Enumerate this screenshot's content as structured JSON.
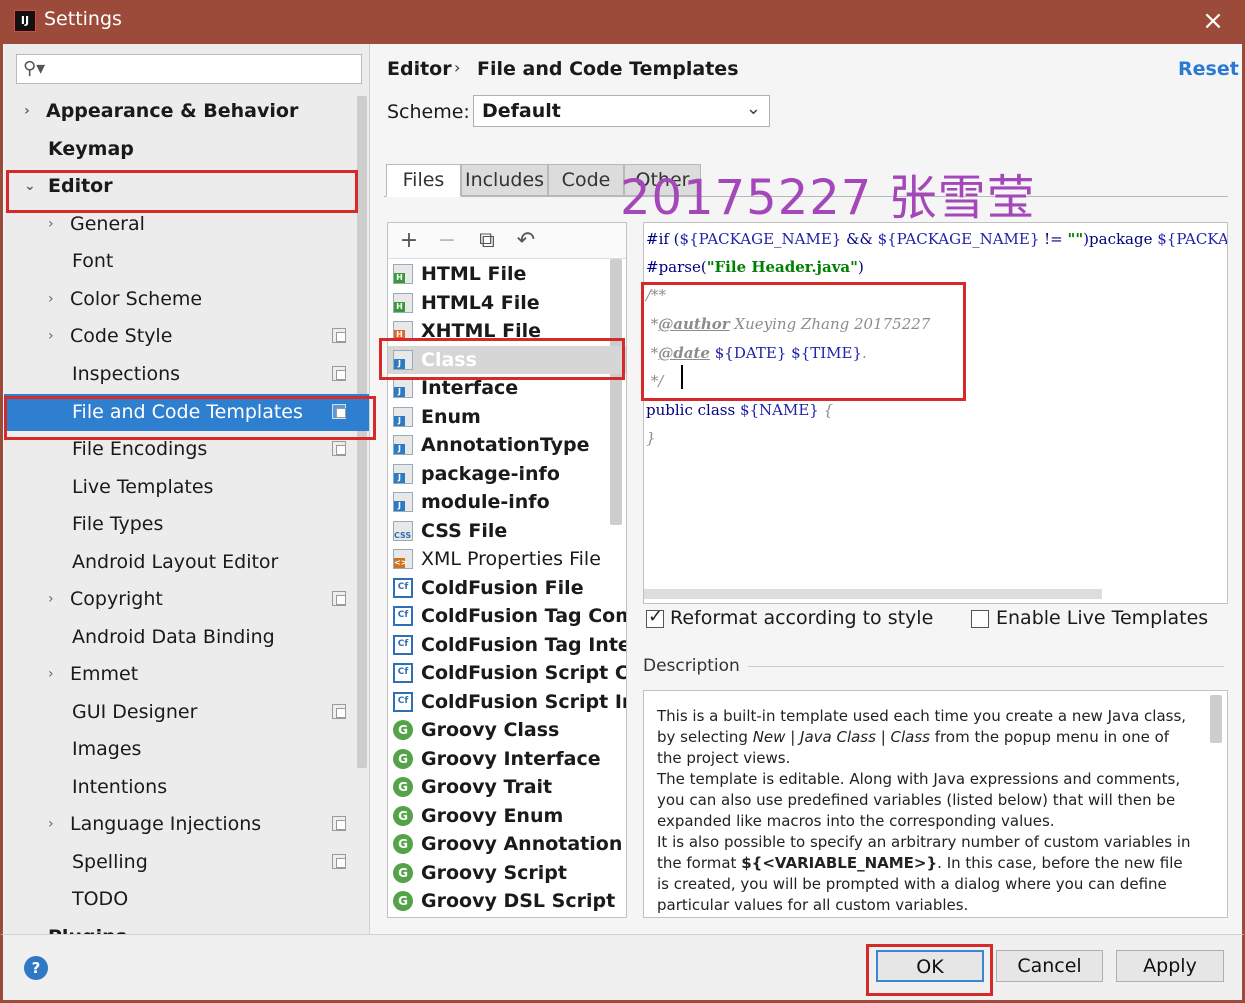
{
  "window": {
    "title": "Settings",
    "app_icon_text": "IJ",
    "close_symbol": "×"
  },
  "sidebar": {
    "search_placeholder": "",
    "items": [
      {
        "label": "Appearance & Behavior"
      },
      {
        "label": "Keymap"
      },
      {
        "label": "Editor"
      },
      {
        "label": "General"
      },
      {
        "label": "Font"
      },
      {
        "label": "Color Scheme"
      },
      {
        "label": "Code Style"
      },
      {
        "label": "Inspections"
      },
      {
        "label": "File and Code Templates"
      },
      {
        "label": "File Encodings"
      },
      {
        "label": "Live Templates"
      },
      {
        "label": "File Types"
      },
      {
        "label": "Android Layout Editor"
      },
      {
        "label": "Copyright"
      },
      {
        "label": "Android Data Binding"
      },
      {
        "label": "Emmet"
      },
      {
        "label": "GUI Designer"
      },
      {
        "label": "Images"
      },
      {
        "label": "Intentions"
      },
      {
        "label": "Language Injections"
      },
      {
        "label": "Spelling"
      },
      {
        "label": "TODO"
      },
      {
        "label": "Plugins"
      }
    ]
  },
  "header": {
    "breadcrumb": [
      "Editor",
      "File and Code Templates"
    ],
    "breadcrumb_sep": "›",
    "reset_label": "Reset",
    "scheme_label": "Scheme:",
    "scheme_value": "Default"
  },
  "tabs": [
    {
      "label": "Files"
    },
    {
      "label": "Includes"
    },
    {
      "label": "Code"
    },
    {
      "label": "Other"
    }
  ],
  "watermark": "20175227 张雪莹",
  "templates": [
    {
      "label": "HTML File",
      "badge": "H"
    },
    {
      "label": "HTML4 File",
      "badge": "H"
    },
    {
      "label": "XHTML File",
      "badge": "H"
    },
    {
      "label": "Class",
      "badge": "J"
    },
    {
      "label": "Interface",
      "badge": "J"
    },
    {
      "label": "Enum",
      "badge": "J"
    },
    {
      "label": "AnnotationType",
      "badge": "J"
    },
    {
      "label": "package-info",
      "badge": "J"
    },
    {
      "label": "module-info",
      "badge": "J"
    },
    {
      "label": "CSS File",
      "badge": "CSS"
    },
    {
      "label": "XML Properties File",
      "badge": "<>"
    },
    {
      "label": "ColdFusion File",
      "badge": "Cf"
    },
    {
      "label": "ColdFusion Tag Compo",
      "badge": "Cf"
    },
    {
      "label": "ColdFusion Tag Interfa",
      "badge": "Cf"
    },
    {
      "label": "ColdFusion Script Com",
      "badge": "Cf"
    },
    {
      "label": "ColdFusion Script Inter",
      "badge": "Cf"
    },
    {
      "label": "Groovy Class",
      "badge": "G"
    },
    {
      "label": "Groovy Interface",
      "badge": "G"
    },
    {
      "label": "Groovy Trait",
      "badge": "G"
    },
    {
      "label": "Groovy Enum",
      "badge": "G"
    },
    {
      "label": "Groovy Annotation",
      "badge": "G"
    },
    {
      "label": "Groovy Script",
      "badge": "G"
    },
    {
      "label": "Groovy DSL Script",
      "badge": "G"
    }
  ],
  "toolbar_icons": [
    "plus-icon",
    "minus-icon",
    "copy-icon",
    "revert-icon"
  ],
  "editor": {
    "line1": {
      "a": "#if (",
      "b": "${PACKAGE_NAME}",
      "c": " && ",
      "d": "${PACKAGE_NAME}",
      "e": " != ",
      "f": "\"\"",
      "g": ")package ",
      "h": "${PACKAGE_NAME}"
    },
    "line2": {
      "a": "#parse(",
      "b": "\"File Header.java\"",
      "c": ")"
    },
    "line3": "/**",
    "line4": {
      "a": " *",
      "b": "@author",
      "c": " Xueying Zhang 20175227"
    },
    "line5": {
      "a": " *",
      "b": "@date",
      "c": " ",
      "d": "${DATE}",
      "e": " ",
      "f": "${TIME}",
      "g": "."
    },
    "line6": " */",
    "line7": {
      "a": "public class ",
      "b": "${NAME}",
      "c": " {"
    },
    "line8": "}"
  },
  "options": {
    "reformat_label": "Reformat according to style",
    "reformat_checked": true,
    "live_templates_label": "Enable Live Templates",
    "live_templates_checked": false
  },
  "description": {
    "title": "Description",
    "p1a": "This is a built-in template used each time you create a new Java class, by selecting ",
    "p1_new": "New",
    "p1_sep1": " | ",
    "p1_javaclass": "Java Class",
    "p1_sep2": " | ",
    "p1_class": "Class",
    "p1b": " from the popup menu in one of the project views.",
    "p2": "The template is editable. Along with Java expressions and comments, you can also use predefined variables (listed below) that will then be expanded like macros into the corresponding values.",
    "p3a": "It is also possible to specify an arbitrary number of custom variables in the format ",
    "p3_var": "${<VARIABLE_NAME>}",
    "p3b": ". In this case, before the new file is created, you will be prompted with a dialog where you can define particular values for all custom variables."
  },
  "footer": {
    "help": "?",
    "ok": "OK",
    "cancel": "Cancel",
    "apply": "Apply"
  },
  "colors": {
    "title_bar": "#9c4a3a",
    "selection": "#2e7fd0",
    "link": "#2a7ad1",
    "annotation": "#d42a2a",
    "watermark": "#a447b8"
  }
}
